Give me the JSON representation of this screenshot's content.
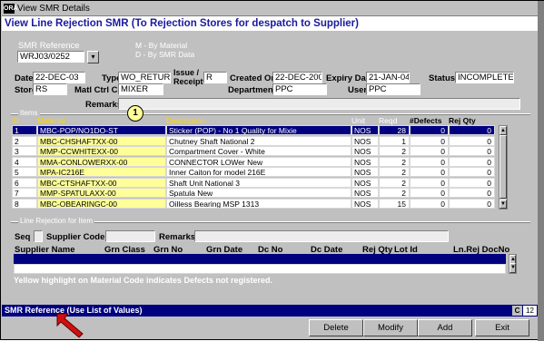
{
  "window": {
    "title": "View SMR Details",
    "app_badge": "ORA"
  },
  "header": {
    "title": "View Line Rejection SMR (To Rejection Stores for despatch to Supplier)"
  },
  "smr_ref": {
    "label": "SMR Reference",
    "value": "WRJ03/0252",
    "lov": "▾",
    "hint1": "M - By Material",
    "hint2": "D - By SMR Data"
  },
  "form": {
    "date_label": "Date",
    "date": "22-DEC-03",
    "type_label": "Type",
    "type": "WO_RETURN",
    "issue_label": "Issue /",
    "issue_label2": "Receipt",
    "issue": "R",
    "created_label": "Created On",
    "created": "22-DEC-2003",
    "expiry_label": "Expiry Date",
    "expiry": "21-JAN-04",
    "status_label": "Status",
    "status": "INCOMPLETE",
    "store_label": "Store",
    "store": "RS",
    "matl_label": "Matl Ctrl Cell",
    "matl": "MIXER",
    "dept_label": "Department",
    "dept": "PPC",
    "user_label": "User",
    "user": "PPC",
    "remarks_label": "Remarks",
    "remarks": ""
  },
  "items_section": {
    "label": "Items"
  },
  "items_grid": {
    "headers": {
      "sl": "Sl",
      "material": "Material",
      "description": "Description",
      "unit": "Unit",
      "reqd": "Reqd",
      "defects": "#Defects",
      "rej": "Rej Qty"
    },
    "rows": [
      {
        "sl": "1",
        "material": "MBC-POP/NO1DO-ST",
        "description": "Sticker (POP) - No 1 Quality for Mixie",
        "unit": "NOS",
        "reqd": "28",
        "defects": "0",
        "rej": "0"
      },
      {
        "sl": "2",
        "material": "MBC-CHSHAFTXX-00",
        "description": "Chutney Shaft National 2",
        "unit": "NOS",
        "reqd": "1",
        "defects": "0",
        "rej": "0"
      },
      {
        "sl": "3",
        "material": "MMP-CCWHITEXX-00",
        "description": "Compartment Cover - White",
        "unit": "NOS",
        "reqd": "2",
        "defects": "0",
        "rej": "0"
      },
      {
        "sl": "4",
        "material": "MMA-CONLOWERXX-00",
        "description": "CONNECTOR LOWer New",
        "unit": "NOS",
        "reqd": "2",
        "defects": "0",
        "rej": "0"
      },
      {
        "sl": "5",
        "material": "MPA-IC216E",
        "description": "Inner Caiton  for model 216E",
        "unit": "NOS",
        "reqd": "2",
        "defects": "0",
        "rej": "0"
      },
      {
        "sl": "6",
        "material": "MBC-CTSHAFTXX-00",
        "description": "Shaft Unit National 3",
        "unit": "NOS",
        "reqd": "2",
        "defects": "0",
        "rej": "0"
      },
      {
        "sl": "7",
        "material": "MMP-SPATULAXX-00",
        "description": "Spatula New",
        "unit": "NOS",
        "reqd": "2",
        "defects": "0",
        "rej": "0"
      },
      {
        "sl": "8",
        "material": "MBC-OBEARINGC-00",
        "description": "Oilless Bearing MSP 1313",
        "unit": "NOS",
        "reqd": "15",
        "defects": "0",
        "rej": "0"
      }
    ]
  },
  "badge": "1",
  "rejection_section": {
    "label": "Line Rejection for Item"
  },
  "rejection_header": {
    "seq": "Seq",
    "supplier_code": "Supplier Code",
    "remarks": "Remarks"
  },
  "rejection_grid": {
    "headers": {
      "supplier": "Supplier Name",
      "grn_class": "Grn Class",
      "grn_no": "Grn No",
      "grn_date": "Grn Date",
      "dc_no": "Dc No",
      "dc_date": "Dc Date",
      "rej_qty": "Rej Qty",
      "lot_id": "Lot Id",
      "ln_rej": "Ln.Rej DocNo"
    }
  },
  "note": "Yellow highlight on Material Code indicates Defects not registered.",
  "statusbar": {
    "text": "SMR Reference (Use List of Values)",
    "mode": "C",
    "count": "12"
  },
  "buttons": {
    "delete": "Delete",
    "modify": "Modify",
    "add": "Add",
    "exit": "Exit"
  }
}
